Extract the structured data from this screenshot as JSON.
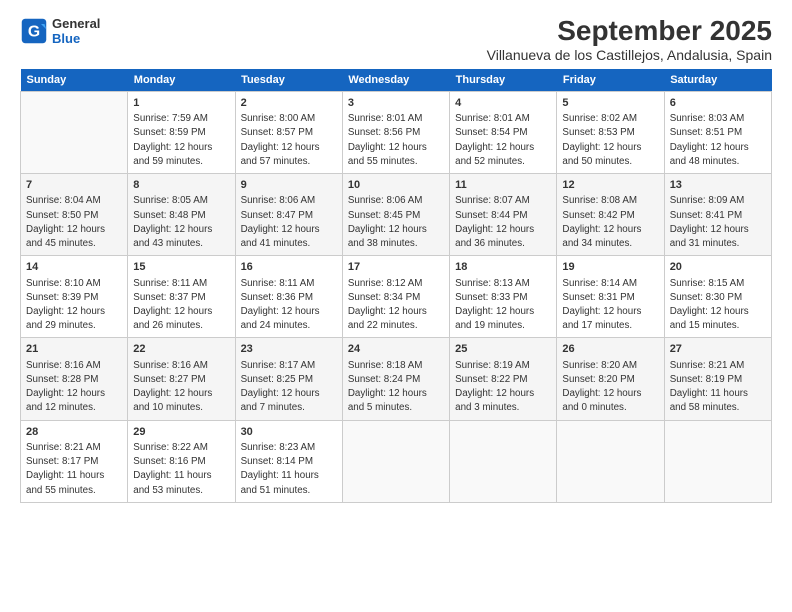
{
  "logo": {
    "line1": "General",
    "line2": "Blue"
  },
  "title": "September 2025",
  "subtitle": "Villanueva de los Castillejos, Andalusia, Spain",
  "header_days": [
    "Sunday",
    "Monday",
    "Tuesday",
    "Wednesday",
    "Thursday",
    "Friday",
    "Saturday"
  ],
  "weeks": [
    [
      {
        "day": "",
        "info": ""
      },
      {
        "day": "1",
        "info": "Sunrise: 7:59 AM\nSunset: 8:59 PM\nDaylight: 12 hours\nand 59 minutes."
      },
      {
        "day": "2",
        "info": "Sunrise: 8:00 AM\nSunset: 8:57 PM\nDaylight: 12 hours\nand 57 minutes."
      },
      {
        "day": "3",
        "info": "Sunrise: 8:01 AM\nSunset: 8:56 PM\nDaylight: 12 hours\nand 55 minutes."
      },
      {
        "day": "4",
        "info": "Sunrise: 8:01 AM\nSunset: 8:54 PM\nDaylight: 12 hours\nand 52 minutes."
      },
      {
        "day": "5",
        "info": "Sunrise: 8:02 AM\nSunset: 8:53 PM\nDaylight: 12 hours\nand 50 minutes."
      },
      {
        "day": "6",
        "info": "Sunrise: 8:03 AM\nSunset: 8:51 PM\nDaylight: 12 hours\nand 48 minutes."
      }
    ],
    [
      {
        "day": "7",
        "info": "Sunrise: 8:04 AM\nSunset: 8:50 PM\nDaylight: 12 hours\nand 45 minutes."
      },
      {
        "day": "8",
        "info": "Sunrise: 8:05 AM\nSunset: 8:48 PM\nDaylight: 12 hours\nand 43 minutes."
      },
      {
        "day": "9",
        "info": "Sunrise: 8:06 AM\nSunset: 8:47 PM\nDaylight: 12 hours\nand 41 minutes."
      },
      {
        "day": "10",
        "info": "Sunrise: 8:06 AM\nSunset: 8:45 PM\nDaylight: 12 hours\nand 38 minutes."
      },
      {
        "day": "11",
        "info": "Sunrise: 8:07 AM\nSunset: 8:44 PM\nDaylight: 12 hours\nand 36 minutes."
      },
      {
        "day": "12",
        "info": "Sunrise: 8:08 AM\nSunset: 8:42 PM\nDaylight: 12 hours\nand 34 minutes."
      },
      {
        "day": "13",
        "info": "Sunrise: 8:09 AM\nSunset: 8:41 PM\nDaylight: 12 hours\nand 31 minutes."
      }
    ],
    [
      {
        "day": "14",
        "info": "Sunrise: 8:10 AM\nSunset: 8:39 PM\nDaylight: 12 hours\nand 29 minutes."
      },
      {
        "day": "15",
        "info": "Sunrise: 8:11 AM\nSunset: 8:37 PM\nDaylight: 12 hours\nand 26 minutes."
      },
      {
        "day": "16",
        "info": "Sunrise: 8:11 AM\nSunset: 8:36 PM\nDaylight: 12 hours\nand 24 minutes."
      },
      {
        "day": "17",
        "info": "Sunrise: 8:12 AM\nSunset: 8:34 PM\nDaylight: 12 hours\nand 22 minutes."
      },
      {
        "day": "18",
        "info": "Sunrise: 8:13 AM\nSunset: 8:33 PM\nDaylight: 12 hours\nand 19 minutes."
      },
      {
        "day": "19",
        "info": "Sunrise: 8:14 AM\nSunset: 8:31 PM\nDaylight: 12 hours\nand 17 minutes."
      },
      {
        "day": "20",
        "info": "Sunrise: 8:15 AM\nSunset: 8:30 PM\nDaylight: 12 hours\nand 15 minutes."
      }
    ],
    [
      {
        "day": "21",
        "info": "Sunrise: 8:16 AM\nSunset: 8:28 PM\nDaylight: 12 hours\nand 12 minutes."
      },
      {
        "day": "22",
        "info": "Sunrise: 8:16 AM\nSunset: 8:27 PM\nDaylight: 12 hours\nand 10 minutes."
      },
      {
        "day": "23",
        "info": "Sunrise: 8:17 AM\nSunset: 8:25 PM\nDaylight: 12 hours\nand 7 minutes."
      },
      {
        "day": "24",
        "info": "Sunrise: 8:18 AM\nSunset: 8:24 PM\nDaylight: 12 hours\nand 5 minutes."
      },
      {
        "day": "25",
        "info": "Sunrise: 8:19 AM\nSunset: 8:22 PM\nDaylight: 12 hours\nand 3 minutes."
      },
      {
        "day": "26",
        "info": "Sunrise: 8:20 AM\nSunset: 8:20 PM\nDaylight: 12 hours\nand 0 minutes."
      },
      {
        "day": "27",
        "info": "Sunrise: 8:21 AM\nSunset: 8:19 PM\nDaylight: 11 hours\nand 58 minutes."
      }
    ],
    [
      {
        "day": "28",
        "info": "Sunrise: 8:21 AM\nSunset: 8:17 PM\nDaylight: 11 hours\nand 55 minutes."
      },
      {
        "day": "29",
        "info": "Sunrise: 8:22 AM\nSunset: 8:16 PM\nDaylight: 11 hours\nand 53 minutes."
      },
      {
        "day": "30",
        "info": "Sunrise: 8:23 AM\nSunset: 8:14 PM\nDaylight: 11 hours\nand 51 minutes."
      },
      {
        "day": "",
        "info": ""
      },
      {
        "day": "",
        "info": ""
      },
      {
        "day": "",
        "info": ""
      },
      {
        "day": "",
        "info": ""
      }
    ]
  ]
}
